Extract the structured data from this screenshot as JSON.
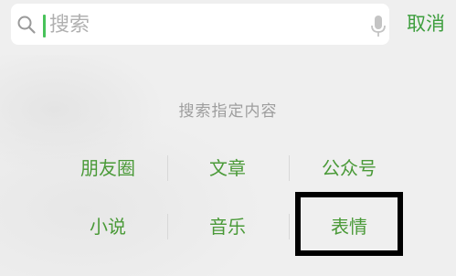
{
  "search": {
    "placeholder": "搜索",
    "value": "",
    "cancel_label": "取消"
  },
  "icons": {
    "search": "search-icon",
    "mic": "microphone-icon"
  },
  "section": {
    "title": "搜索指定内容"
  },
  "options": [
    {
      "label": "朋友圈"
    },
    {
      "label": "文章"
    },
    {
      "label": "公众号"
    },
    {
      "label": "小说"
    },
    {
      "label": "音乐"
    },
    {
      "label": "表情"
    }
  ],
  "colors": {
    "accent_green": "#4a9a38",
    "caret_green": "#48c25a",
    "highlight_border": "#000000"
  }
}
